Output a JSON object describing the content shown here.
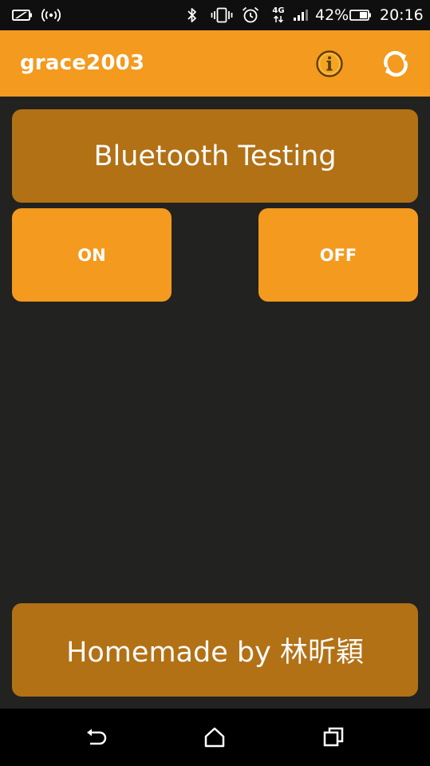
{
  "status_bar": {
    "battery_percent": "42%",
    "time": "20:16",
    "network_type": "4G",
    "icons": [
      "battery-saver-icon",
      "nfc-signal-icon",
      "bluetooth-icon",
      "vibrate-icon",
      "alarm-clock-icon",
      "mobile-data-icon",
      "cell-signal-icon",
      "battery-icon"
    ]
  },
  "app_bar": {
    "title": "grace2003",
    "actions": [
      "info-icon",
      "refresh-icon"
    ]
  },
  "main": {
    "header_label": "Bluetooth Testing",
    "on_label": "ON",
    "off_label": "OFF",
    "footer_label": "Homemade by 林昕穎"
  },
  "nav_bar": {
    "buttons": [
      "back-icon",
      "home-icon",
      "recent-apps-icon"
    ]
  },
  "colors": {
    "accent": "#f39a1f",
    "banner": "#b27115",
    "background": "#222220"
  }
}
